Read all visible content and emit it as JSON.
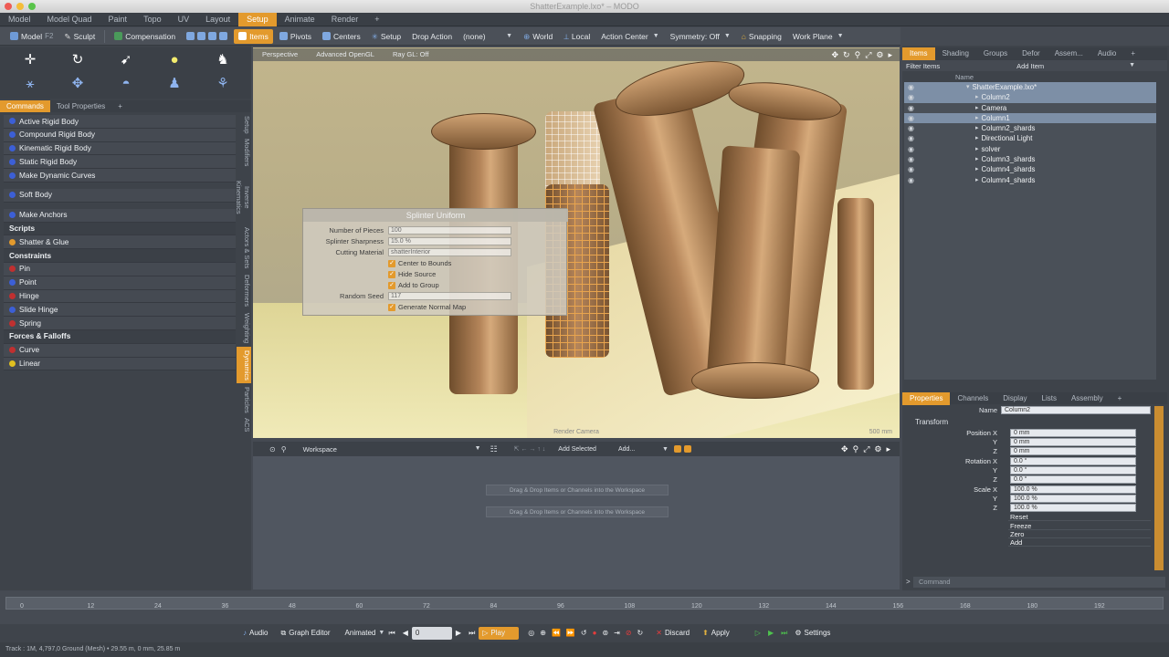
{
  "window": {
    "title": "ShatterExample.lxo* – MODO"
  },
  "tabs": [
    "Model",
    "Model Quad",
    "Paint",
    "Topo",
    "UV",
    "Layout",
    "Setup",
    "Animate",
    "Render",
    "+"
  ],
  "active_tab": "Setup",
  "toolbar": {
    "model": "Model",
    "model_key": "F2",
    "sculpt": "Sculpt",
    "compensation": "Compensation",
    "items": "Items",
    "pivots": "Pivots",
    "centers": "Centers",
    "setup": "Setup",
    "drop_action_label": "Drop Action",
    "drop_action_value": "(none)",
    "world": "World",
    "local": "Local",
    "action_center": "Action Center",
    "symmetry": "Symmetry: Off",
    "snapping": "Snapping",
    "work_plane": "Work Plane"
  },
  "left_tabs": [
    "Commands",
    "Tool Properties",
    "+"
  ],
  "commands": [
    {
      "label": "Active Rigid Body",
      "color": "#3c5fd6"
    },
    {
      "label": "Compound Rigid Body",
      "color": "#3c5fd6"
    },
    {
      "label": "Kinematic Rigid Body",
      "color": "#3c5fd6"
    },
    {
      "label": "Static Rigid Body",
      "color": "#3c5fd6"
    },
    {
      "label": "Make Dynamic Curves",
      "color": "#3c5fd6"
    },
    {
      "label": "Soft Body",
      "color": "#3c5fd6"
    },
    {
      "label": "Make Anchors",
      "color": "#3c5fd6"
    },
    {
      "label": "Scripts",
      "color": ""
    },
    {
      "label": "Shatter & Glue",
      "color": "#e39a2d"
    },
    {
      "label": "Constraints",
      "color": ""
    },
    {
      "label": "Pin",
      "color": "#c03030"
    },
    {
      "label": "Point",
      "color": "#3c5fd6"
    },
    {
      "label": "Hinge",
      "color": "#c03030"
    },
    {
      "label": "Slide Hinge",
      "color": "#3c5fd6"
    },
    {
      "label": "Spring",
      "color": "#c03030"
    },
    {
      "label": "Forces & Falloffs",
      "color": ""
    },
    {
      "label": "Curve",
      "color": "#c03030"
    },
    {
      "label": "Linear",
      "color": "#e0c020"
    }
  ],
  "vertical_tabs": [
    "Setup",
    "Modifiers",
    "Inverse Kinematics",
    "Actors & Sets",
    "Deformers",
    "Weighting",
    "Dynamics",
    "Particles",
    "ACS"
  ],
  "viewport": {
    "labels": [
      "Perspective",
      "Advanced OpenGL",
      "Ray GL: Off"
    ],
    "status": "Render Camera",
    "scale": "500 mm"
  },
  "dialog": {
    "title": "Splinter Uniform",
    "fields": [
      {
        "label": "Number of Pieces",
        "value": "100"
      },
      {
        "label": "Splinter Sharpness",
        "value": "15.0 %"
      },
      {
        "label": "Cutting Material",
        "value": "shatterInterior"
      }
    ],
    "checks": [
      "Center to Bounds",
      "Hide Source",
      "Add to Group"
    ],
    "random_seed_label": "Random Seed",
    "random_seed_value": "117",
    "generate_normal_map": "Generate Normal Map"
  },
  "workspace": {
    "label": "Workspace",
    "add_selected": "Add Selected",
    "add": "Add...",
    "messages": [
      "Drag & Drop Items or Channels into the Workspace",
      "Drag & Drop Items or Channels into the Workspace"
    ]
  },
  "right_tabs": [
    "Items",
    "Shading",
    "Groups",
    "Defor",
    "Assem...",
    "Audio",
    "+"
  ],
  "filter_items": "Filter Items",
  "add_item": "Add Item",
  "items_header": "Name",
  "items": [
    {
      "name": "ShatterExample.lxo*",
      "sel": true,
      "indent": 0
    },
    {
      "name": "Column2",
      "sel": true,
      "indent": 1
    },
    {
      "name": "Camera",
      "sel": false,
      "indent": 1
    },
    {
      "name": "Column1",
      "sel": true,
      "indent": 1
    },
    {
      "name": "Column2_shards",
      "sel": false,
      "indent": 1
    },
    {
      "name": "Directional Light",
      "sel": false,
      "indent": 1
    },
    {
      "name": "solver",
      "sel": false,
      "indent": 1
    },
    {
      "name": "Column3_shards",
      "sel": false,
      "indent": 1
    },
    {
      "name": "Column4_shards",
      "sel": false,
      "indent": 1
    },
    {
      "name": "Column4_shards",
      "sel": false,
      "indent": 1
    }
  ],
  "prop_tabs": [
    "Properties",
    "Channels",
    "Display",
    "Lists",
    "Assembly",
    "+"
  ],
  "properties": {
    "name_label": "Name",
    "name_value": "Column2",
    "transform": "Transform",
    "position_label": "Position X",
    "rotation_label": "Rotation X",
    "scale_label": "Scale X",
    "position": [
      "0 mm",
      "0 mm",
      "0 mm"
    ],
    "rotation": [
      "0.0 °",
      "0.0 °",
      "0.0 °"
    ],
    "scale": [
      "100.0 %",
      "100.0 %",
      "100.0 %"
    ],
    "buttons": [
      "Reset",
      "Freeze",
      "Zero",
      "Add"
    ]
  },
  "command_line": "Command",
  "timeline": {
    "ticks": [
      "0",
      "12",
      "24",
      "36",
      "48",
      "60",
      "72",
      "84",
      "96",
      "108",
      "120",
      "132",
      "144",
      "156",
      "168",
      "180",
      "192"
    ]
  },
  "transport": {
    "audio": "Audio",
    "graph_editor": "Graph Editor",
    "animated": "Animated",
    "frame": "0",
    "play": "Play",
    "discard": "Discard",
    "apply": "Apply",
    "settings": "Settings"
  },
  "status": "Track : 1M, 4,797,0 Ground (Mesh) • 29.55 m, 0 mm, 25.85 m",
  "colors": {
    "accent": "#e39a2d",
    "panel": "#3e434a",
    "selection": "#7d8fa6"
  }
}
